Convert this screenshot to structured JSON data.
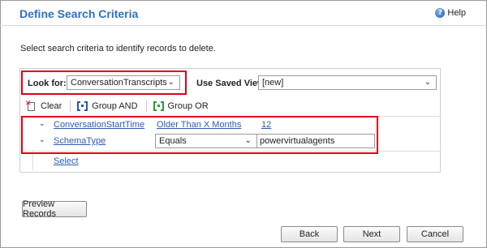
{
  "dialog": {
    "title": "Define Search Criteria",
    "help_label": "Help",
    "help_icon": "?",
    "instruction": "Select search criteria to identify records to delete."
  },
  "lookfor": {
    "label": "Look for:",
    "value": "ConversationTranscripts"
  },
  "saved_view": {
    "label": "Use Saved View:",
    "value": "[new]"
  },
  "toolbar": {
    "clear_label": "Clear",
    "group_and_label": "Group AND",
    "group_or_label": "Group OR"
  },
  "criteria": [
    {
      "field": "ConversationStartTime",
      "operator": "Older Than X Months",
      "value": "12"
    },
    {
      "field": "SchemaType",
      "operator": "Equals",
      "value": "powervirtualagents"
    }
  ],
  "select_link": "Select",
  "buttons": {
    "preview": "Preview Records",
    "back": "Back",
    "next": "Next",
    "cancel": "Cancel"
  },
  "colors": {
    "title": "#2e70c1",
    "link": "#2b5bb5",
    "highlight": "#e0001b"
  }
}
